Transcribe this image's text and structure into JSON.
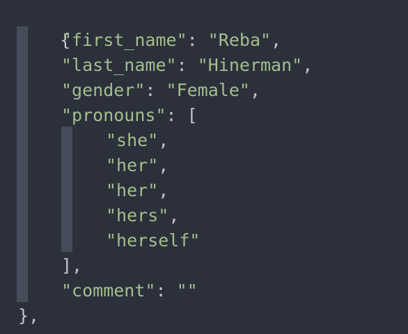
{
  "editor": {
    "lines": [
      {
        "parts": [
          "{"
        ]
      },
      {
        "key": "\"first_name\"",
        "sep": ": ",
        "value": "\"Reba\"",
        "end": ","
      },
      {
        "key": "\"last_name\"",
        "sep": ": ",
        "value": "\"Hinerman\"",
        "end": ","
      },
      {
        "key": "\"gender\"",
        "sep": ": ",
        "value": "\"Female\"",
        "end": ","
      },
      {
        "key": "\"pronouns\"",
        "sep": ": ",
        "open": "["
      },
      {
        "value": "\"she\"",
        "end": ","
      },
      {
        "value": "\"her\"",
        "end": ","
      },
      {
        "value": "\"her\"",
        "end": ","
      },
      {
        "value": "\"hers\"",
        "end": ","
      },
      {
        "value": "\"herself\""
      },
      {
        "close": "],"
      },
      {
        "key": "\"comment\"",
        "sep": ": ",
        "value": "\"\""
      },
      {
        "close": "},"
      }
    ]
  },
  "colors": {
    "background": "#2b303b",
    "string": "#a3be8c",
    "punctuation": "#c0c5ce",
    "indent_guide": "#464c5a"
  }
}
